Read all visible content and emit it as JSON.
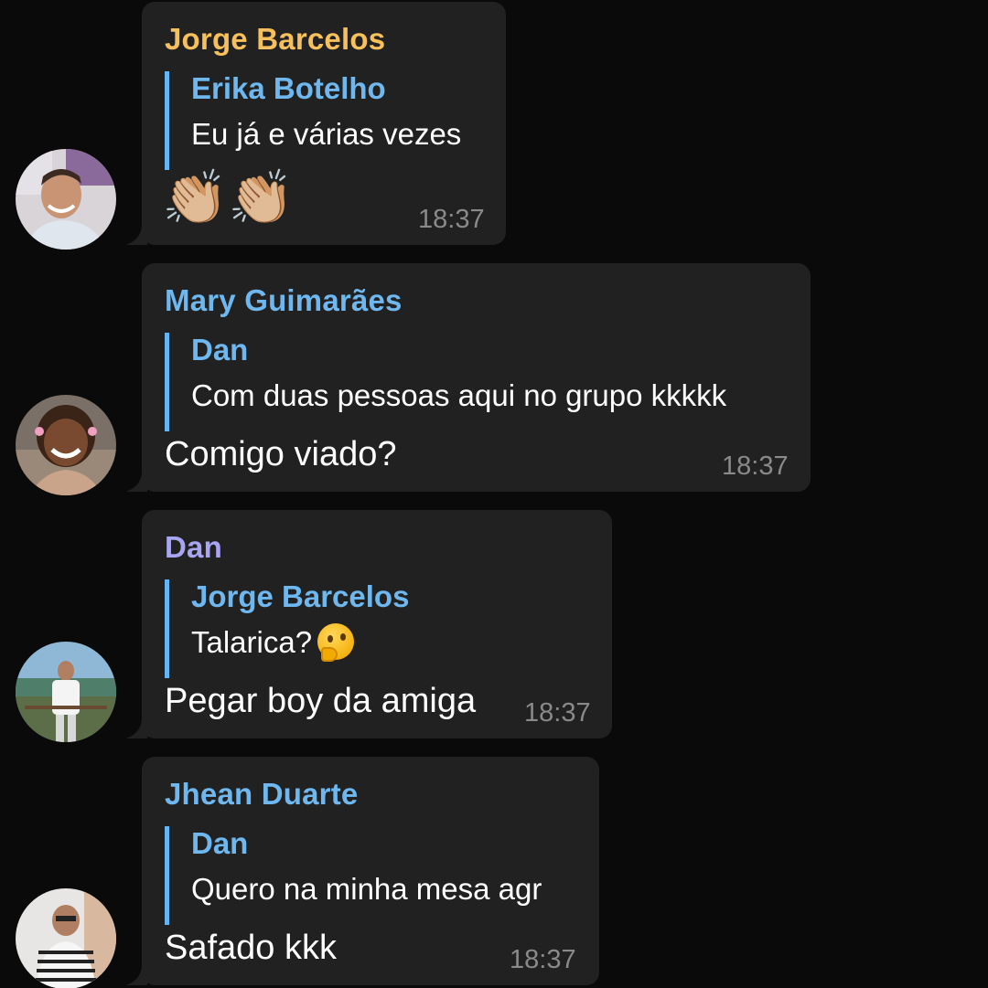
{
  "messages": [
    {
      "sender": "Jorge Barcelos",
      "sender_color": "#f6c15c",
      "avatar_icon": "user-avatar-photo",
      "reply_author": "Erika Botelho",
      "reply_text": "Eu já e várias vezes",
      "body": "👏🏼👏🏼",
      "time": "18:37"
    },
    {
      "sender": "Mary Guimarães",
      "sender_color": "#6fb7ef",
      "avatar_icon": "user-avatar-photo",
      "reply_author": "Dan",
      "reply_text": "Com duas pessoas aqui no grupo kkkkk",
      "body": "Comigo viado?",
      "time": "18:37"
    },
    {
      "sender": "Dan",
      "sender_color": "#a8a6f0",
      "avatar_icon": "user-avatar-photo",
      "reply_author": "Jorge Barcelos",
      "reply_text": "Talarica?",
      "reply_emoji": "thinking-face-icon",
      "body": "Pegar boy da amiga",
      "time": "18:37"
    },
    {
      "sender": "Jhean Duarte",
      "sender_color": "#6fb7ef",
      "avatar_icon": "user-avatar-photo",
      "reply_author": "Dan",
      "reply_text": "Quero na minha mesa agr",
      "body": "Safado kkk",
      "time": "18:37"
    }
  ],
  "colors": {
    "background": "#0a0a0a",
    "bubble": "#212121",
    "reply_bar": "#64b5f6",
    "timestamp": "#8a8a8a"
  }
}
